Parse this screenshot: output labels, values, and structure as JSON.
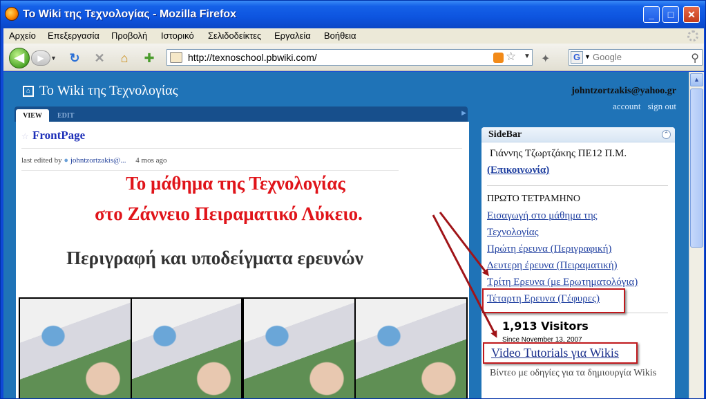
{
  "window": {
    "title": "Το Wiki της Τεχνολογίας - Mozilla Firefox",
    "minimize": "_",
    "maximize": "□",
    "close": "✕"
  },
  "menu": [
    "Αρχείο",
    "Επεξεργασία",
    "Προβολή",
    "Ιστορικό",
    "Σελιδοδείκτες",
    "Εργαλεία",
    "Βοήθεια"
  ],
  "navbar": {
    "url": "http://texnoschool.pbwiki.com/",
    "search_placeholder": "Google"
  },
  "site": {
    "title": "Το Wiki της Τεχνολογίας",
    "user_email": "johntzortzakis@yahoo.gr",
    "account_link": "account",
    "signout_link": "sign out"
  },
  "tabs": {
    "view": "VIEW",
    "edit": "EDIT"
  },
  "page": {
    "name": "FrontPage",
    "edited_prefix": "last edited by",
    "edited_user": "johntzortzakis@...",
    "edited_when": "4 mos ago",
    "headline_1": "Το μάθημα της Τεχνολογίας",
    "headline_2": "στο Ζάννειο Πειραματικό Λύκειο.",
    "subheading": "Περιγραφή και υποδείγματα ερευνών"
  },
  "sidebar": {
    "title": "SideBar",
    "author": "Γιάννης Τζωρτζάκης ΠΕ12 Π.Μ.",
    "contact_link": "(Επικοινωνία)",
    "section_title": "ΠΡΩΤΟ ΤΕΤΡΑΜΗΝΟ",
    "links": [
      "Εισαγωγή στο μάθημα της",
      "Τεχνολογίας",
      "Πρώτη έρευνα (Περιγραφική)",
      "Δευτερη έρευνα (Πειραματική)",
      "Τρίτη Ερευνα (με Ερωτηματολόγια)",
      "Τέταρτη Ερευνα (Γέφυρες)"
    ],
    "visitors": "1,913 Visitors",
    "visitors_since": "Since November 13, 2007",
    "video_link": "Video Tutorials για Wikis",
    "video_desc": "Βίντεο με οδηγίες για τα δημιουργία Wikis"
  },
  "colors": {
    "headline_red": "#e0141a",
    "annotation_red": "#c0181c",
    "wiki_blue": "#1f73b7",
    "xp_title_blue": "#0d54df"
  }
}
